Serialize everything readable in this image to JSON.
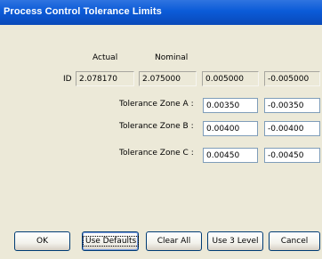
{
  "window": {
    "title": "Process Control Tolerance Limits"
  },
  "headers": {
    "actual": "Actual",
    "nominal": "Nominal"
  },
  "id_row": {
    "label": "ID",
    "actual": "2.078170",
    "nominal": "2.075000",
    "plus_tol": "0.005000",
    "minus_tol": "-0.005000"
  },
  "zones": [
    {
      "label": "Tolerance Zone A :",
      "upper": "0.00350",
      "lower": "-0.00350"
    },
    {
      "label": "Tolerance Zone B :",
      "upper": "0.00400",
      "lower": "-0.00400"
    },
    {
      "label": "Tolerance Zone C :",
      "upper": "0.00450",
      "lower": "-0.00450"
    }
  ],
  "buttons": {
    "ok": "OK",
    "use_defaults": "Use Defaults",
    "clear_all": "Clear All",
    "use_3_level": "Use 3 Level",
    "cancel": "Cancel"
  }
}
